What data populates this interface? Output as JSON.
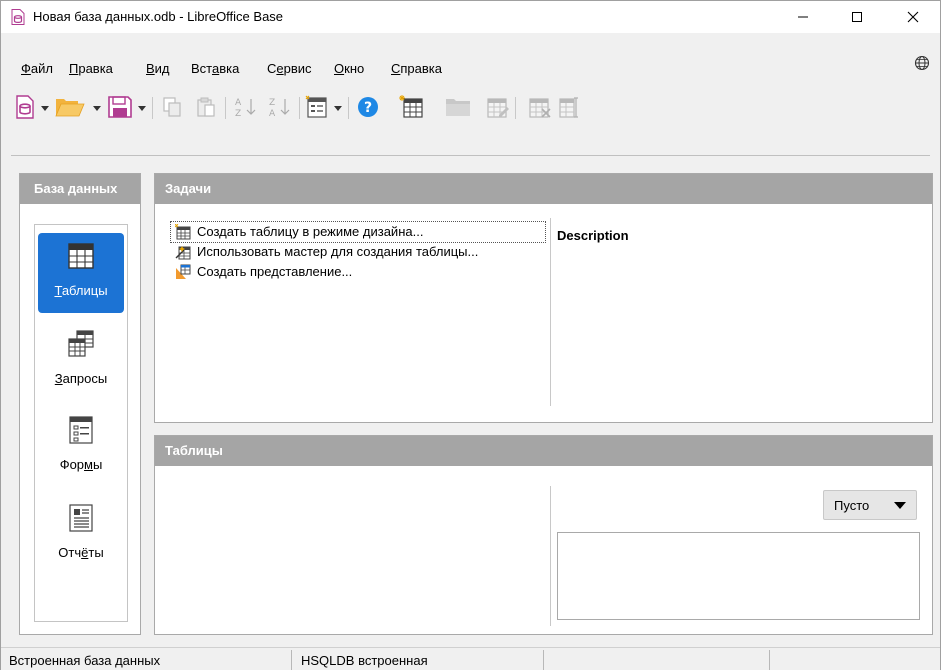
{
  "window": {
    "title": "Новая база данных.odb - LibreOffice Base",
    "controls": [
      "minimize",
      "maximize",
      "close"
    ]
  },
  "menu": [
    {
      "underline": "Ф",
      "rest": "айл"
    },
    {
      "underline": "П",
      "rest": "равка"
    },
    {
      "underline": "В",
      "rest": "ид"
    },
    {
      "pre": "Вст",
      "underline": "а",
      "rest": "вка"
    },
    {
      "pre": "С",
      "underline": "е",
      "rest": "рвис"
    },
    {
      "underline": "О",
      "rest": "кно"
    },
    {
      "underline": "С",
      "rest": "правка"
    }
  ],
  "toolbar": {
    "icons": [
      "new-database-icon",
      "open-folder-icon",
      "save-icon",
      "copy-icon",
      "paste-icon",
      "sort-ascending-icon",
      "sort-descending-icon",
      "form-icon",
      "help-icon",
      "new-table-icon",
      "open-object-icon",
      "edit-table-icon",
      "delete-table-icon",
      "rename-icon"
    ]
  },
  "left_panel": {
    "header": "База данных",
    "items": [
      {
        "pre": "",
        "underline": "Т",
        "rest": "аблицы",
        "selected": true,
        "icon": "table-icon"
      },
      {
        "pre": "",
        "underline": "З",
        "rest": "апросы",
        "selected": false,
        "icon": "query-icon"
      },
      {
        "pre": "Фор",
        "underline": "м",
        "rest": "ы",
        "selected": false,
        "icon": "form-icon"
      },
      {
        "pre": "Отч",
        "underline": "ё",
        "rest": "ты",
        "selected": false,
        "icon": "report-icon"
      }
    ]
  },
  "tasks_panel": {
    "header": "Задачи",
    "items": [
      "Создать таблицу в режиме дизайна...",
      "Использовать мастер для создания таблицы...",
      "Создать представление..."
    ],
    "description_label": "Description"
  },
  "tables_panel": {
    "header": "Таблицы",
    "preview_select": "Пусто"
  },
  "statusbar": {
    "cells": [
      "Встроенная база данных",
      "HSQLDB встроенная",
      "",
      ""
    ]
  },
  "colors": {
    "panel_header": "#a5a5a5",
    "selection": "#1c73d4"
  }
}
